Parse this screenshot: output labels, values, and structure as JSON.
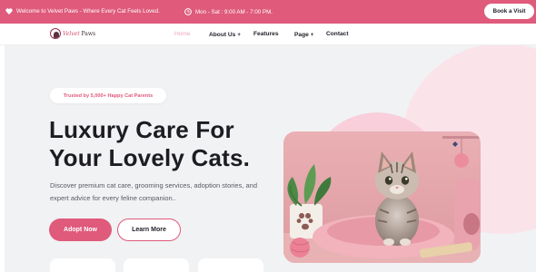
{
  "topbar": {
    "welcome": "Welcome to Velvet Paws - Where Every Cat Feels Loved.",
    "hours": "Mon - Sat : 9:00 AM - 7:00 PM.",
    "book_label": "Book a Visit"
  },
  "brand": {
    "word_first": "Velvet",
    "word_second": "Paws"
  },
  "nav": {
    "home": "Home",
    "about": "About Us",
    "features": "Features",
    "page": "Page",
    "contact": "Contact"
  },
  "hero": {
    "trust": "Trusted by 5,000+ Happy Cat Parents",
    "headline_line1": "Luxury Care For",
    "headline_line2": "Your Lovely Cats.",
    "description": "Discover premium cat care, grooming services, adoption stories, and expert advice for every feline companion..",
    "adopt_label": "Adopt Now",
    "learn_label": "Learn More"
  },
  "colors": {
    "accent": "#df5a7b",
    "accent_light": "#fbe3ea",
    "hero_bg": "#f1f2f4"
  },
  "icons": {
    "welcome": "heart-icon",
    "hours": "clock-icon",
    "dropdown": "plus-icon"
  }
}
